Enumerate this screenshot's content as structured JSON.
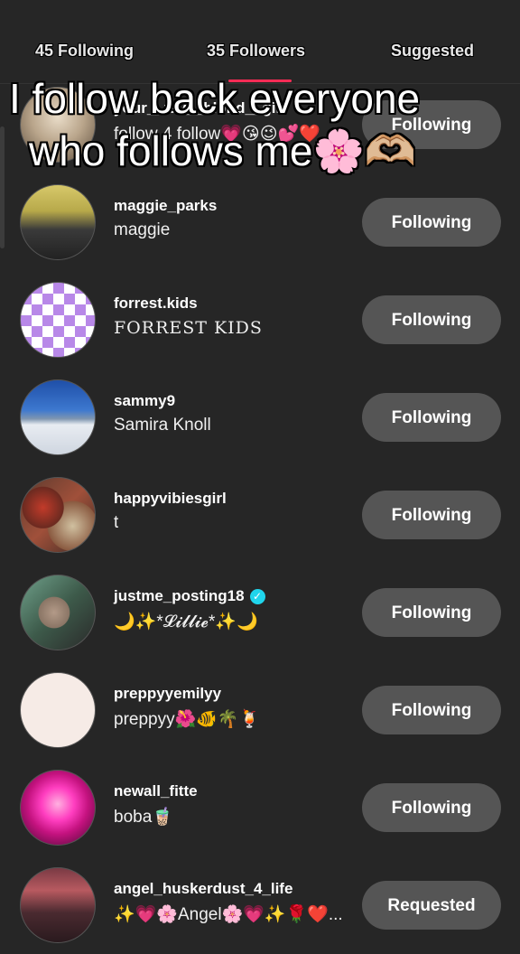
{
  "tabs": {
    "following": "45 Following",
    "followers": "35 Followers",
    "suggested": "Suggested"
  },
  "overlay": {
    "line1": "I follow back everyone",
    "line2": "who follows me🌸🫶🏼"
  },
  "rows": [
    {
      "username": "your__fav__blond__girl",
      "nickname": "follow 4 follow💗😘😉💕❤️",
      "button": "Following",
      "verified": false
    },
    {
      "username": "maggie_parks",
      "nickname": "maggie",
      "button": "Following",
      "verified": false
    },
    {
      "username": "forrest.kids",
      "nickname": "FORREST KIDS",
      "button": "Following",
      "verified": false
    },
    {
      "username": "sammy9",
      "nickname": "Samira Knoll",
      "button": "Following",
      "verified": false
    },
    {
      "username": "happyvibiesgirl",
      "nickname": "t",
      "button": "Following",
      "verified": false
    },
    {
      "username": "justme_posting18",
      "nickname": "🌙✨*𝓛𝓲𝓵𝓵𝓲𝓮*✨🌙",
      "button": "Following",
      "verified": true
    },
    {
      "username": "preppyyemilyy",
      "nickname": "preppyy🌺🐠🌴🍹",
      "button": "Following",
      "verified": false
    },
    {
      "username": "newall_fitte",
      "nickname": "boba🧋",
      "button": "Following",
      "verified": false
    },
    {
      "username": "angel_huskerdust_4_life",
      "nickname": "✨💗🌸Angel🌸💗✨🌹❤️...",
      "button": "Requested",
      "verified": false
    }
  ],
  "colors": {
    "background": "#262626",
    "button": "#555555",
    "accent": "#fe2c55",
    "verified": "#20d5ec"
  }
}
